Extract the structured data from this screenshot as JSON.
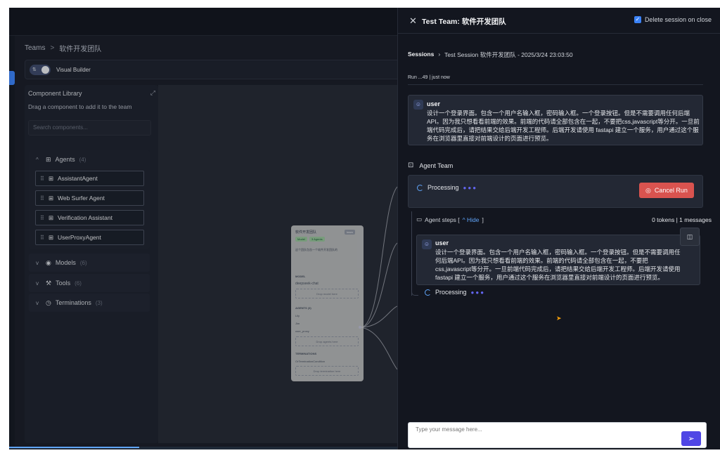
{
  "breadcrumb": {
    "root": "Teams",
    "sep": ">",
    "current": "软件开发团队"
  },
  "builder": {
    "toggle_icon": "⇅",
    "label": "Visual Builder"
  },
  "library": {
    "title": "Component Library",
    "subtitle": "Drag a component to add it to the team",
    "search_placeholder": "Search components...",
    "groups": [
      {
        "label": "Agents",
        "count": "(4)"
      },
      {
        "label": "Models",
        "count": "(6)"
      },
      {
        "label": "Tools",
        "count": "(6)"
      },
      {
        "label": "Terminations",
        "count": "(3)"
      }
    ],
    "agents": [
      "AssistantAgent",
      "Web Surfer Agent",
      "Verification Assistant",
      "UserProxyAgent"
    ]
  },
  "node": {
    "title": "软件开发团队",
    "badge": "team",
    "tag_model": "Model",
    "tag_agents": "3 Agents",
    "desc": "这个团队包含一个软件开发团队的",
    "model_section": "MODEL",
    "model_name": "deepseek-chat",
    "drop_model": "Drop model here",
    "agents_section": "AGENTS (3)",
    "agent_names": [
      "Lily",
      "Jim",
      "user_proxy"
    ],
    "drop_agents": "Drop agents here",
    "term_section": "TERMINATIONS",
    "term_name": "OrTerminationCondition",
    "drop_term": "Drop termination here"
  },
  "panel": {
    "title": "Test Team: 软件开发团队",
    "delete_label": "Delete session on close",
    "sessions_label": "Sessions",
    "session_name": "Test Session 软件开发团队 - 2025/3/24 23:03:50",
    "run_line": "Run ...49 | just now",
    "user_label": "user",
    "user_message": "设计一个登录界面。包含一个用户名输入框，密码输入框。一个登录按钮。但是不需要调用任何后端API。因为我只想看看前端的效果。前端的代码请全部包含在一起，不要把css,javascript等分开。一旦前端代码完成后，请把结果交给后端开发工程师。后端开发请使用 fastapi 建立一个服务，用户通过这个服务在浏览器里直接对前端设计的页面进行预览。",
    "team_label": "Agent Team",
    "processing": "Processing",
    "cancel_label": "Cancel Run",
    "steps_label": "Agent steps [",
    "hide_label": "Hide",
    "steps_close": "]",
    "steps_stats": "0 tokens | 1 messages",
    "message_placeholder": "Type your message here..."
  },
  "colors": {
    "accent": "#3b82f6",
    "cancel": "#d9534f",
    "send": "#4f46e5"
  }
}
